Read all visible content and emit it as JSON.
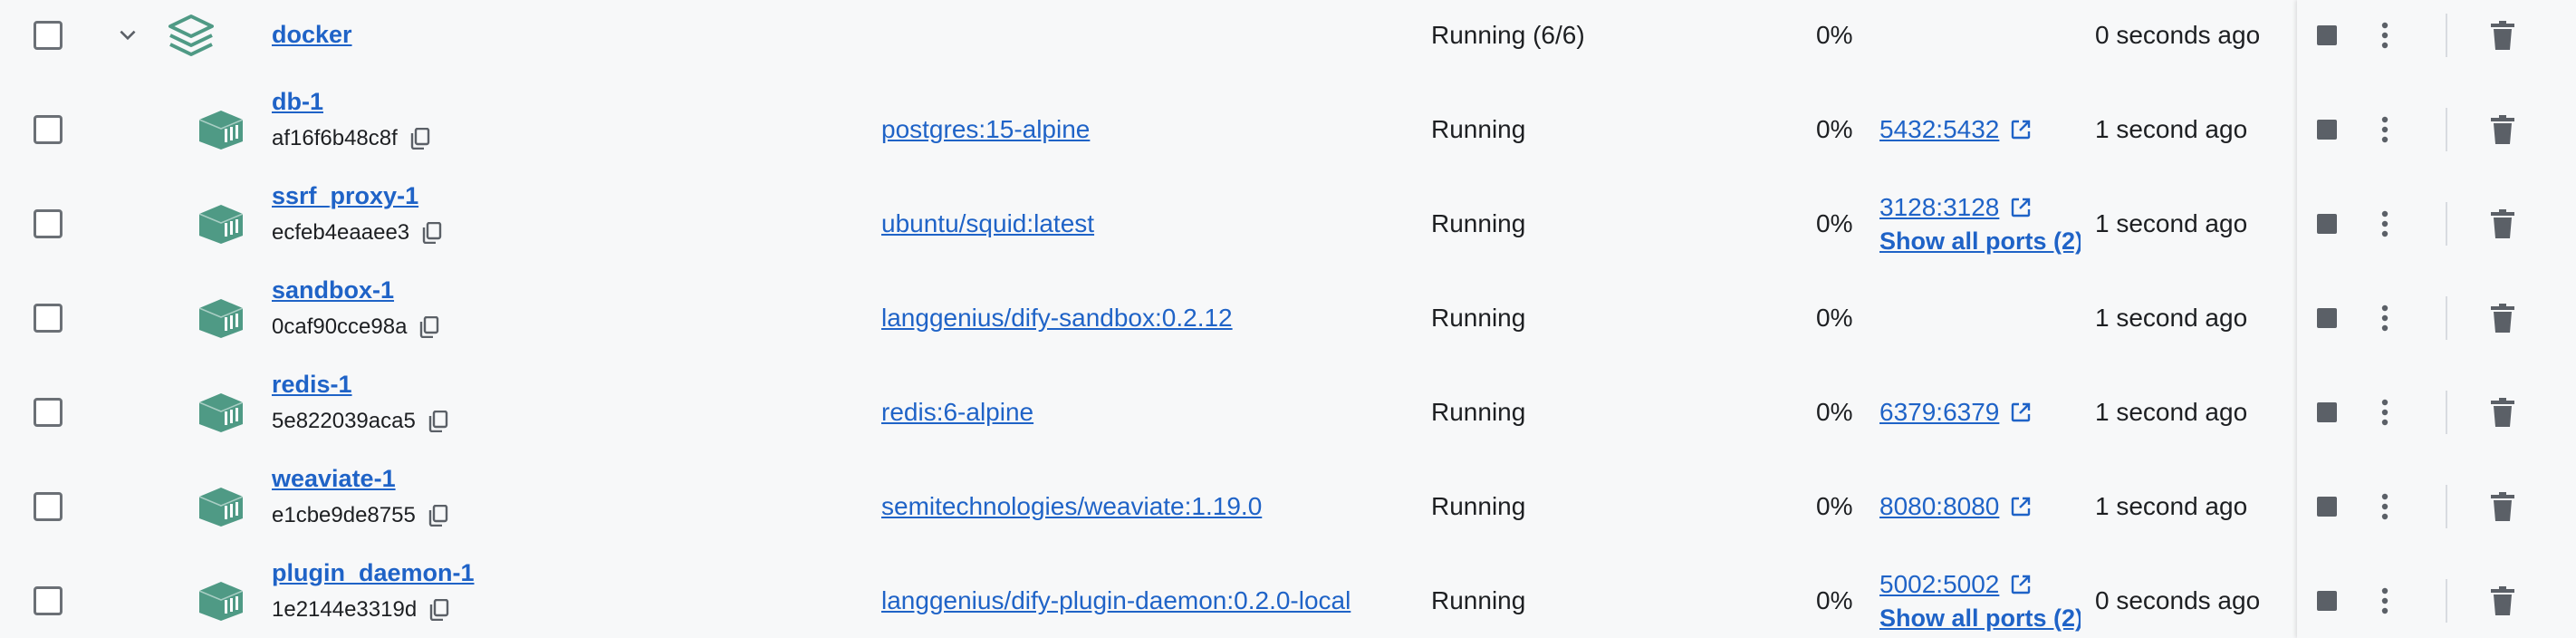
{
  "group": {
    "name": "docker",
    "status": "Running (6/6)",
    "cpu": "0%",
    "last_started": "0 seconds ago"
  },
  "containers": [
    {
      "name": "db-1",
      "id": "af16f6b48c8f",
      "image": "postgres:15-alpine",
      "status": "Running",
      "cpu": "0%",
      "port": "5432:5432",
      "show_all": "",
      "last_started": "1 second ago"
    },
    {
      "name": "ssrf_proxy-1",
      "id": "ecfeb4eaaee3",
      "image": "ubuntu/squid:latest",
      "status": "Running",
      "cpu": "0%",
      "port": "3128:3128",
      "show_all": "Show all ports (2)",
      "last_started": "1 second ago"
    },
    {
      "name": "sandbox-1",
      "id": "0caf90cce98a",
      "image": "langgenius/dify-sandbox:0.2.12",
      "status": "Running",
      "cpu": "0%",
      "port": "",
      "show_all": "",
      "last_started": "1 second ago"
    },
    {
      "name": "redis-1",
      "id": "5e822039aca5",
      "image": "redis:6-alpine",
      "status": "Running",
      "cpu": "0%",
      "port": "6379:6379",
      "show_all": "",
      "last_started": "1 second ago"
    },
    {
      "name": "weaviate-1",
      "id": "e1cbe9de8755",
      "image": "semitechnologies/weaviate:1.19.0",
      "status": "Running",
      "cpu": "0%",
      "port": "8080:8080",
      "show_all": "",
      "last_started": "1 second ago"
    },
    {
      "name": "plugin_daemon-1",
      "id": "1e2144e3319d",
      "image": "langgenius/dify-plugin-daemon:0.2.0-local",
      "status": "Running",
      "cpu": "0%",
      "port": "5002:5002",
      "show_all": "Show all ports (2)",
      "last_started": "0 seconds ago"
    }
  ],
  "icons": {
    "group": "stack-icon",
    "container": "container-cube-icon",
    "copy": "copy-icon",
    "external": "external-link-icon",
    "stop": "stop-icon",
    "more": "more-vertical-icon",
    "delete": "trash-icon",
    "expand": "chevron-down-icon"
  },
  "colors": {
    "link": "#1f63c7",
    "icon_green": "#4f9a85",
    "background": "#f7f8f9"
  }
}
